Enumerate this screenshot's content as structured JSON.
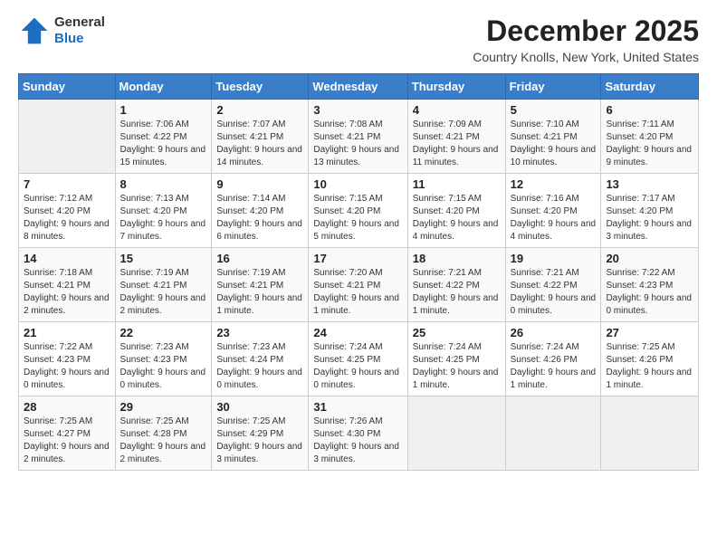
{
  "header": {
    "logo_line1": "General",
    "logo_line2": "Blue",
    "month": "December 2025",
    "location": "Country Knolls, New York, United States"
  },
  "weekdays": [
    "Sunday",
    "Monday",
    "Tuesday",
    "Wednesday",
    "Thursday",
    "Friday",
    "Saturday"
  ],
  "weeks": [
    [
      {
        "day": "",
        "sunrise": "",
        "sunset": "",
        "daylight": ""
      },
      {
        "day": "1",
        "sunrise": "7:06 AM",
        "sunset": "4:22 PM",
        "daylight": "9 hours and 15 minutes."
      },
      {
        "day": "2",
        "sunrise": "7:07 AM",
        "sunset": "4:21 PM",
        "daylight": "9 hours and 14 minutes."
      },
      {
        "day": "3",
        "sunrise": "7:08 AM",
        "sunset": "4:21 PM",
        "daylight": "9 hours and 13 minutes."
      },
      {
        "day": "4",
        "sunrise": "7:09 AM",
        "sunset": "4:21 PM",
        "daylight": "9 hours and 11 minutes."
      },
      {
        "day": "5",
        "sunrise": "7:10 AM",
        "sunset": "4:21 PM",
        "daylight": "9 hours and 10 minutes."
      },
      {
        "day": "6",
        "sunrise": "7:11 AM",
        "sunset": "4:20 PM",
        "daylight": "9 hours and 9 minutes."
      }
    ],
    [
      {
        "day": "7",
        "sunrise": "7:12 AM",
        "sunset": "4:20 PM",
        "daylight": "9 hours and 8 minutes."
      },
      {
        "day": "8",
        "sunrise": "7:13 AM",
        "sunset": "4:20 PM",
        "daylight": "9 hours and 7 minutes."
      },
      {
        "day": "9",
        "sunrise": "7:14 AM",
        "sunset": "4:20 PM",
        "daylight": "9 hours and 6 minutes."
      },
      {
        "day": "10",
        "sunrise": "7:15 AM",
        "sunset": "4:20 PM",
        "daylight": "9 hours and 5 minutes."
      },
      {
        "day": "11",
        "sunrise": "7:15 AM",
        "sunset": "4:20 PM",
        "daylight": "9 hours and 4 minutes."
      },
      {
        "day": "12",
        "sunrise": "7:16 AM",
        "sunset": "4:20 PM",
        "daylight": "9 hours and 4 minutes."
      },
      {
        "day": "13",
        "sunrise": "7:17 AM",
        "sunset": "4:20 PM",
        "daylight": "9 hours and 3 minutes."
      }
    ],
    [
      {
        "day": "14",
        "sunrise": "7:18 AM",
        "sunset": "4:21 PM",
        "daylight": "9 hours and 2 minutes."
      },
      {
        "day": "15",
        "sunrise": "7:19 AM",
        "sunset": "4:21 PM",
        "daylight": "9 hours and 2 minutes."
      },
      {
        "day": "16",
        "sunrise": "7:19 AM",
        "sunset": "4:21 PM",
        "daylight": "9 hours and 1 minute."
      },
      {
        "day": "17",
        "sunrise": "7:20 AM",
        "sunset": "4:21 PM",
        "daylight": "9 hours and 1 minute."
      },
      {
        "day": "18",
        "sunrise": "7:21 AM",
        "sunset": "4:22 PM",
        "daylight": "9 hours and 1 minute."
      },
      {
        "day": "19",
        "sunrise": "7:21 AM",
        "sunset": "4:22 PM",
        "daylight": "9 hours and 0 minutes."
      },
      {
        "day": "20",
        "sunrise": "7:22 AM",
        "sunset": "4:23 PM",
        "daylight": "9 hours and 0 minutes."
      }
    ],
    [
      {
        "day": "21",
        "sunrise": "7:22 AM",
        "sunset": "4:23 PM",
        "daylight": "9 hours and 0 minutes."
      },
      {
        "day": "22",
        "sunrise": "7:23 AM",
        "sunset": "4:23 PM",
        "daylight": "9 hours and 0 minutes."
      },
      {
        "day": "23",
        "sunrise": "7:23 AM",
        "sunset": "4:24 PM",
        "daylight": "9 hours and 0 minutes."
      },
      {
        "day": "24",
        "sunrise": "7:24 AM",
        "sunset": "4:25 PM",
        "daylight": "9 hours and 0 minutes."
      },
      {
        "day": "25",
        "sunrise": "7:24 AM",
        "sunset": "4:25 PM",
        "daylight": "9 hours and 1 minute."
      },
      {
        "day": "26",
        "sunrise": "7:24 AM",
        "sunset": "4:26 PM",
        "daylight": "9 hours and 1 minute."
      },
      {
        "day": "27",
        "sunrise": "7:25 AM",
        "sunset": "4:26 PM",
        "daylight": "9 hours and 1 minute."
      }
    ],
    [
      {
        "day": "28",
        "sunrise": "7:25 AM",
        "sunset": "4:27 PM",
        "daylight": "9 hours and 2 minutes."
      },
      {
        "day": "29",
        "sunrise": "7:25 AM",
        "sunset": "4:28 PM",
        "daylight": "9 hours and 2 minutes."
      },
      {
        "day": "30",
        "sunrise": "7:25 AM",
        "sunset": "4:29 PM",
        "daylight": "9 hours and 3 minutes."
      },
      {
        "day": "31",
        "sunrise": "7:26 AM",
        "sunset": "4:30 PM",
        "daylight": "9 hours and 3 minutes."
      },
      {
        "day": "",
        "sunrise": "",
        "sunset": "",
        "daylight": ""
      },
      {
        "day": "",
        "sunrise": "",
        "sunset": "",
        "daylight": ""
      },
      {
        "day": "",
        "sunrise": "",
        "sunset": "",
        "daylight": ""
      }
    ]
  ]
}
